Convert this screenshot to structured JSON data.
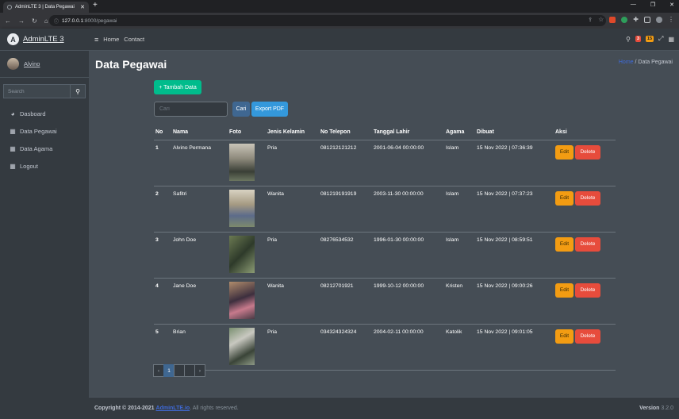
{
  "browser": {
    "tab_title": "AdminLTE 3 | Data Pegawai",
    "url_host": "127.0.0.1",
    "url_path": ":8000/pegawai"
  },
  "brand": {
    "logo_letter": "A",
    "name": "AdminLTE 3"
  },
  "user": {
    "name": "Alvino"
  },
  "sidebar": {
    "search_placeholder": "Search",
    "items": [
      {
        "label": "Dasboard",
        "icon": "tachometer-icon"
      },
      {
        "label": "Data Pegawai",
        "icon": "grid-icon"
      },
      {
        "label": "Data Agama",
        "icon": "grid-icon"
      },
      {
        "label": "Logout",
        "icon": "grid-icon"
      }
    ]
  },
  "topnav": {
    "links": [
      "Home",
      "Contact"
    ],
    "badge_messages": "3",
    "badge_notifications": "15"
  },
  "page": {
    "title": "Data Pegawai",
    "breadcrumb_home": "Home",
    "breadcrumb_current": "Data Pegawai",
    "add_label": "+ Tambah Data",
    "search_placeholder": "Cari",
    "search_label": "Cari",
    "export_label": "Export PDF"
  },
  "table": {
    "headers": [
      "No",
      "Nama",
      "Foto",
      "Jenis Kelamin",
      "No Telepon",
      "Tanggal Lahir",
      "Agama",
      "Dibuat",
      "Aksi"
    ],
    "edit_label": "Edit",
    "delete_label": "Delete",
    "rows": [
      {
        "no": "1",
        "nama": "Alvino Permana",
        "jk": "Pria",
        "telp": "081212121212",
        "lahir": "2001-06-04 00:00:00",
        "agama": "Islam",
        "dibuat": "15 Nov 2022 | 07:36:39"
      },
      {
        "no": "2",
        "nama": "Safitri",
        "jk": "Wanita",
        "telp": "081219191919",
        "lahir": "2003-11-30 00:00:00",
        "agama": "Islam",
        "dibuat": "15 Nov 2022 | 07:37:23"
      },
      {
        "no": "3",
        "nama": "John Doe",
        "jk": "Pria",
        "telp": "08276534532",
        "lahir": "1996-01-30 00:00:00",
        "agama": "Islam",
        "dibuat": "15 Nov 2022 | 08:59:51"
      },
      {
        "no": "4",
        "nama": "Jane Doe",
        "jk": "Wanita",
        "telp": "08212701921",
        "lahir": "1999-10-12 00:00:00",
        "agama": "Kristen",
        "dibuat": "15 Nov 2022 | 09:00:26"
      },
      {
        "no": "5",
        "nama": "Brian",
        "jk": "Pria",
        "telp": "034324324324",
        "lahir": "2004-02-11 00:00:00",
        "agama": "Katolik",
        "dibuat": "15 Nov 2022 | 09:01:05"
      }
    ]
  },
  "pagination": {
    "prev": "‹",
    "pages": [
      "1",
      "2",
      "3"
    ],
    "next": "›",
    "active": "1"
  },
  "footer": {
    "copyright": "Copyright © 2014-2021",
    "link": "AdminLTE.io",
    "rights": ". All rights reserved.",
    "version_label": "Version",
    "version": "3.2.0"
  },
  "colors": {
    "success": "#00bc8c",
    "warning": "#f39c12",
    "danger": "#e74c3c",
    "info": "#3498db"
  }
}
